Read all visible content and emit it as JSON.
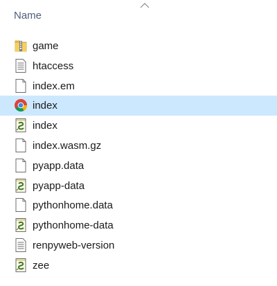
{
  "header": {
    "name_label": "Name"
  },
  "files": [
    {
      "label": "game",
      "icon": "zip-folder-icon",
      "selected": false
    },
    {
      "label": "htaccess",
      "icon": "text-file-icon",
      "selected": false
    },
    {
      "label": "index.em",
      "icon": "blank-file-icon",
      "selected": false
    },
    {
      "label": "index",
      "icon": "chrome-html-icon",
      "selected": true
    },
    {
      "label": "index",
      "icon": "python-script-icon",
      "selected": false
    },
    {
      "label": "index.wasm.gz",
      "icon": "blank-file-icon",
      "selected": false
    },
    {
      "label": "pyapp.data",
      "icon": "blank-file-icon",
      "selected": false
    },
    {
      "label": "pyapp-data",
      "icon": "python-script-icon",
      "selected": false
    },
    {
      "label": "pythonhome.data",
      "icon": "blank-file-icon",
      "selected": false
    },
    {
      "label": "pythonhome-data",
      "icon": "python-script-icon",
      "selected": false
    },
    {
      "label": "renpyweb-version",
      "icon": "text-file-icon",
      "selected": false
    },
    {
      "label": "zee",
      "icon": "python-script-icon",
      "selected": false
    }
  ],
  "colors": {
    "selection": "#cce8ff",
    "header_text": "#4c607a"
  }
}
